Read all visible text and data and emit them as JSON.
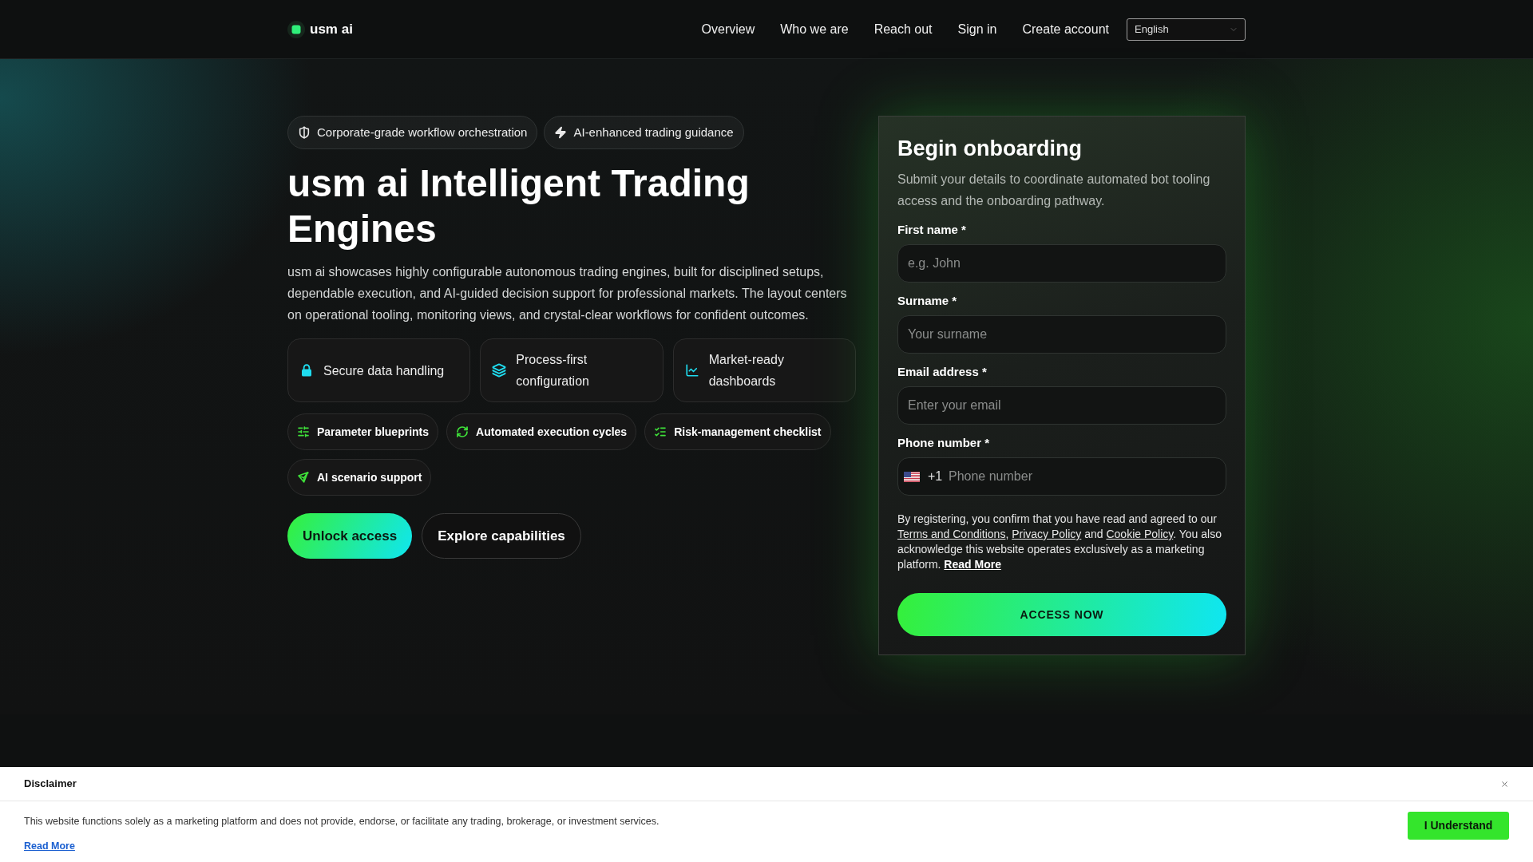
{
  "header": {
    "logo": "usm ai",
    "nav": [
      {
        "label": "Overview"
      },
      {
        "label": "Who we are"
      },
      {
        "label": "Reach out"
      },
      {
        "label": "Sign in"
      },
      {
        "label": "Create account"
      }
    ],
    "language": "English"
  },
  "hero": {
    "badges": [
      "Corporate-grade workflow orchestration",
      "AI-enhanced trading guidance"
    ],
    "title": "usm ai Intelligent Trading Engines",
    "description": "usm ai showcases highly configurable autonomous trading engines, built for disciplined setups, dependable execution, and AI-guided decision support for professional markets. The layout centers on operational tooling, monitoring views, and crystal-clear workflows for confident outcomes.",
    "feature_cards": [
      "Secure data handling",
      "Process-first configuration",
      "Market-ready dashboards"
    ],
    "feature_chips": [
      "Parameter blueprints",
      "Automated execution cycles",
      "Risk-management checklist",
      "AI scenario support"
    ],
    "buttons": [
      {
        "kind": "primary",
        "label": "Unlock access"
      },
      {
        "kind": "secondary",
        "label": "Explore capabilities"
      }
    ]
  },
  "form": {
    "title": "Begin onboarding",
    "description": "Submit your details to coordinate automated bot tooling access and the onboarding pathway.",
    "fields": [
      {
        "kind": "text",
        "label": "First name *",
        "placeholder": "e.g. John"
      },
      {
        "kind": "text",
        "label": "Surname *",
        "placeholder": "Your surname"
      },
      {
        "kind": "email",
        "label": "Email address *",
        "placeholder": "Enter your email"
      },
      {
        "kind": "phone",
        "label": "Phone number *",
        "dial_code": "+1",
        "placeholder": "Phone number"
      }
    ],
    "consent": [
      {
        "kind": "text",
        "text": "By registering, you confirm that you have read and agreed to our "
      },
      {
        "kind": "link",
        "text": "Terms and Conditions"
      },
      {
        "kind": "text",
        "text": ", "
      },
      {
        "kind": "link",
        "text": "Privacy Policy"
      },
      {
        "kind": "text",
        "text": " and "
      },
      {
        "kind": "link",
        "text": "Cookie Policy"
      },
      {
        "kind": "text",
        "text": ". You also acknowledge this website operates exclusively as a marketing platform. "
      },
      {
        "kind": "more",
        "text": "Read More"
      }
    ],
    "submit": "ACCESS NOW"
  },
  "disclaimer": {
    "title": "Disclaimer",
    "text": "This website functions solely as a marketing platform and does not provide, endorse, or facilitate any trading, brokerage, or investment services.",
    "link": "Read More",
    "button": "I Understand"
  }
}
